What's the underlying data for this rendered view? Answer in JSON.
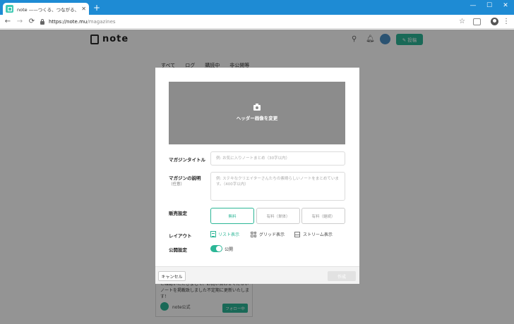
{
  "browser": {
    "tab_title": "note ——つくる、つながる、とどける。",
    "tab_close": "✕",
    "new_tab": "+",
    "window": {
      "minimize": "—",
      "maximize": "☐",
      "close": "✕"
    },
    "nav": {
      "back": "←",
      "forward": "→",
      "reload": "⟳"
    },
    "url_scheme_host": "https://note.mu",
    "url_path": "/magazines",
    "star": "☆",
    "menu": "⋮"
  },
  "site": {
    "logo_text": "note",
    "search": "⚲",
    "bell": "🔔︎",
    "post_button": "✎ 投稿",
    "subnav": [
      "すべて",
      "ログ",
      "購読中",
      "非公開等"
    ],
    "card": {
      "text": "ご確認いただきまして、お問い合わせくださいノートを掲載致しました不定期に更新いたします！",
      "user": "note公式",
      "follow": "フォロー中"
    }
  },
  "modal": {
    "header_image_label": "ヘッダー画像を変更",
    "title_label": "マガジンタイトル",
    "title_placeholder": "例: お気に入りノートまとめ（30字以内）",
    "desc_label": "マガジンの説明",
    "desc_sub": "（任意）",
    "desc_placeholder": "例: ステキなクリエイターさんたちの素晴らしいノートをまとめています。（400字以内）",
    "price_label": "販売設定",
    "price_options": [
      "無料",
      "有料（単体）",
      "有料（継続）"
    ],
    "layout_label": "レイアウト",
    "layout_options": [
      "リスト表示",
      "グリッド表示",
      "ストリーム表示"
    ],
    "visibility_label": "公開設定",
    "visibility_value": "公開",
    "cancel": "キャンセル",
    "save": "作成"
  },
  "colors": {
    "accent": "#2cb696",
    "chrome": "#1e8bd4",
    "header_image": "#8c8c8c"
  }
}
